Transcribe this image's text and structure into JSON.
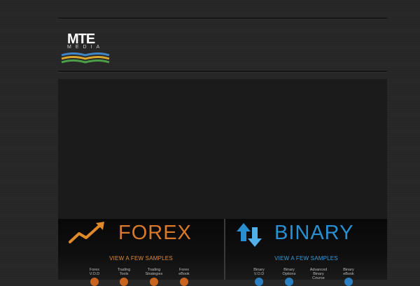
{
  "logo": {
    "brand": "MTE",
    "sub": "MEDIA"
  },
  "forex": {
    "title": "FOREX",
    "samples_label": "VIEW A FEW SAMPLES",
    "items": [
      {
        "line1": "Forex",
        "line2": "V.O.D"
      },
      {
        "line1": "Trading",
        "line2": "Tools"
      },
      {
        "line1": "Trading",
        "line2": "Strategies"
      },
      {
        "line1": "Forex",
        "line2": "eBook"
      }
    ]
  },
  "binary": {
    "title": "BINARY",
    "samples_label": "VIEW A FEW SAMPLES",
    "items": [
      {
        "line1": "Binary",
        "line2": "V.O.D"
      },
      {
        "line1": "Binary",
        "line2": "Options"
      },
      {
        "line1": "Advanced",
        "line2": "Binary",
        "line3": "Course"
      },
      {
        "line1": "Binary",
        "line2": "eBook"
      }
    ]
  },
  "colors": {
    "forex_accent": "#d97a2a",
    "binary_accent": "#2a8fd0",
    "background": "#262626"
  }
}
